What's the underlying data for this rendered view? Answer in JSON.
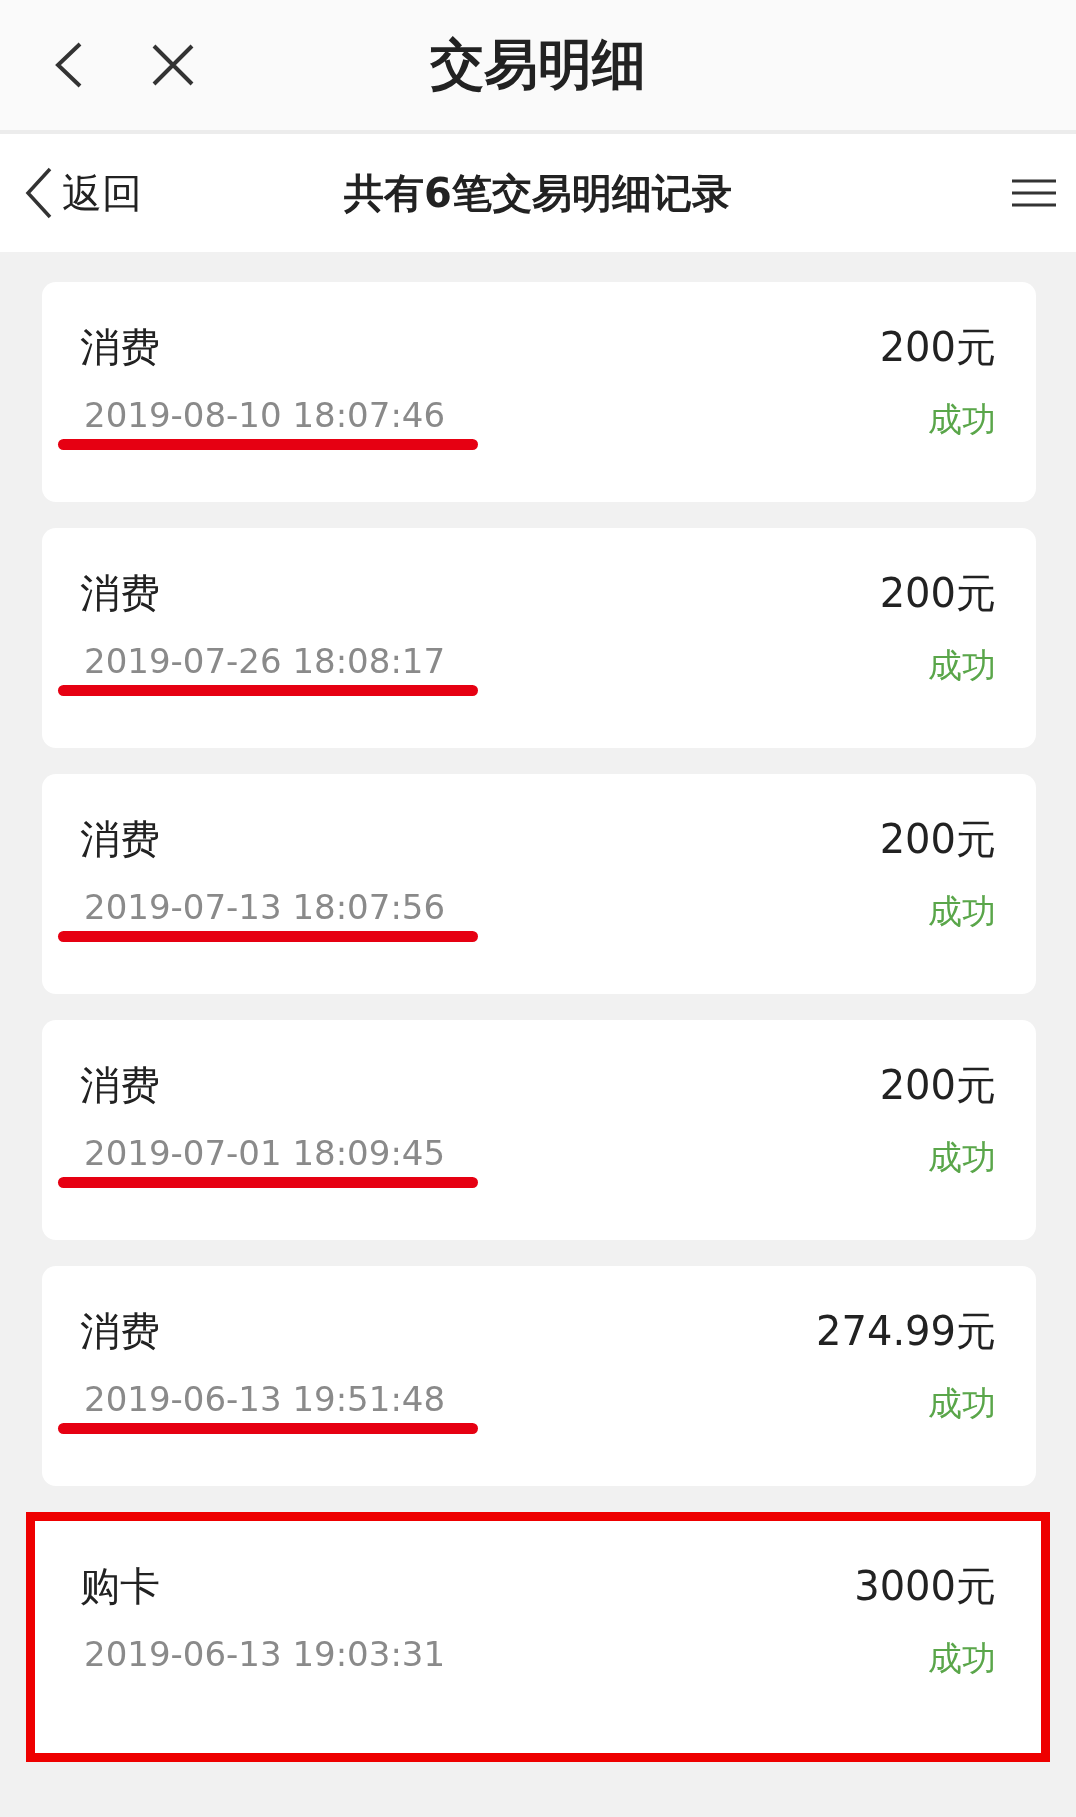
{
  "header": {
    "title": "交易明细"
  },
  "subheader": {
    "back_label": "返回",
    "title": "共有6笔交易明细记录"
  },
  "transactions": [
    {
      "type": "消费",
      "amount": "200元",
      "time": "2019-08-10 18:07:46",
      "status": "成功",
      "underlined": true,
      "boxed": false
    },
    {
      "type": "消费",
      "amount": "200元",
      "time": "2019-07-26 18:08:17",
      "status": "成功",
      "underlined": true,
      "boxed": false
    },
    {
      "type": "消费",
      "amount": "200元",
      "time": "2019-07-13 18:07:56",
      "status": "成功",
      "underlined": true,
      "boxed": false
    },
    {
      "type": "消费",
      "amount": "200元",
      "time": "2019-07-01 18:09:45",
      "status": "成功",
      "underlined": true,
      "boxed": false
    },
    {
      "type": "消费",
      "amount": "274.99元",
      "time": "2019-06-13 19:51:48",
      "status": "成功",
      "underlined": true,
      "boxed": false
    },
    {
      "type": "购卡",
      "amount": "3000元",
      "time": "2019-06-13 19:03:31",
      "status": "成功",
      "underlined": false,
      "boxed": true
    }
  ]
}
